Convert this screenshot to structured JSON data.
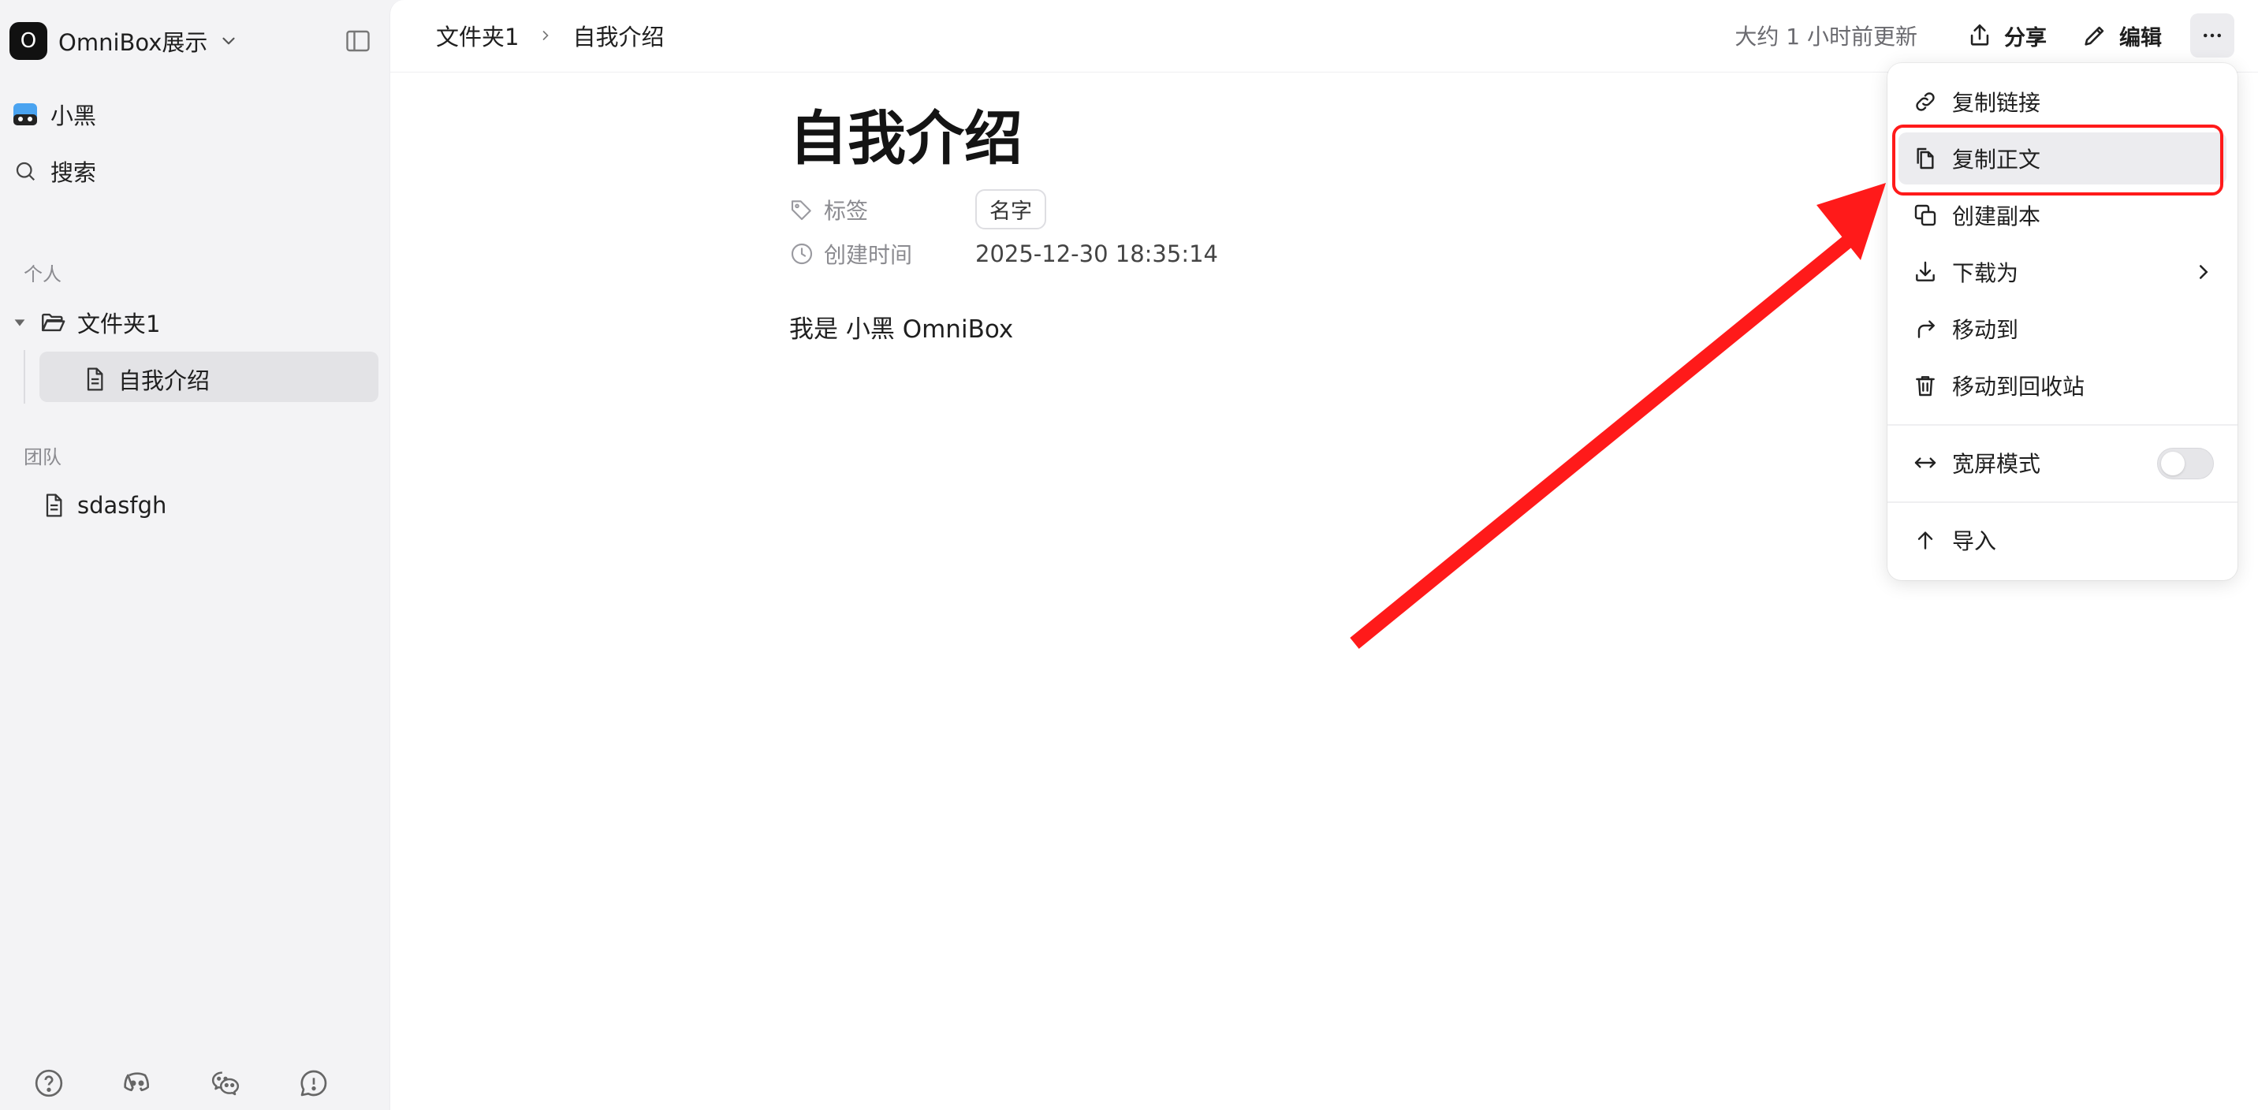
{
  "sidebar": {
    "workspace_initial": "O",
    "workspace_name": "OmniBox展示",
    "user_name": "小黑",
    "search_label": "搜索",
    "section_personal": "个人",
    "folder_name": "文件夹1",
    "active_doc": "自我介绍",
    "section_team": "团队",
    "team_doc": "sdasfgh"
  },
  "topbar": {
    "breadcrumb_folder": "文件夹1",
    "breadcrumb_doc": "自我介绍",
    "updated": "大约 1 小时前更新",
    "share_label": "分享",
    "edit_label": "编辑"
  },
  "doc": {
    "title": "自我介绍",
    "tags_label": "标签",
    "tag_value": "名字",
    "created_label": "创建时间",
    "created_value": "2025-12-30 18:35:14",
    "body": "我是 小黑 OmniBox"
  },
  "menu": {
    "copy_link": "复制链接",
    "copy_body": "复制正文",
    "duplicate": "创建副本",
    "download_as": "下载为",
    "move_to": "移动到",
    "move_to_trash": "移动到回收站",
    "wide_mode": "宽屏模式",
    "wide_mode_on": false,
    "import": "导入"
  },
  "colors": {
    "annotation_red": "#ff1a1a",
    "accent_dark": "#111111"
  }
}
